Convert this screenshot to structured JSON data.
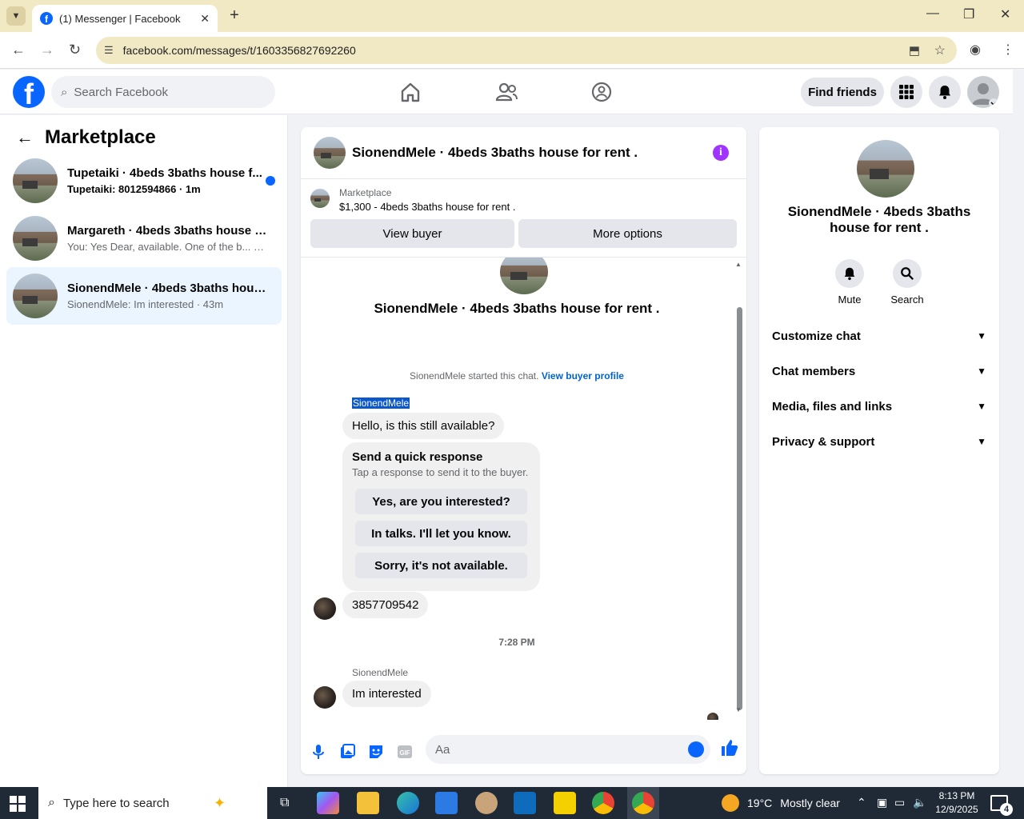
{
  "browser": {
    "tab_title": "(1) Messenger | Facebook",
    "url": "facebook.com/messages/t/1603356827692260"
  },
  "fb": {
    "search_placeholder": "Search Facebook",
    "find_friends": "Find friends"
  },
  "sidebar": {
    "title": "Marketplace",
    "conversations": [
      {
        "name": "Tupetaiki · 4beds 3baths house f...",
        "snippet": "Tupetaiki: 8012594866 · 1m",
        "unread": true,
        "active": false
      },
      {
        "name": "Margareth · 4beds 3baths house f...",
        "snippet": "You: Yes Dear, available. One of the b... · 2m",
        "unread": false,
        "active": false
      },
      {
        "name": "SionendMele · 4beds 3baths hous...",
        "snippet": "SionendMele: Im interested · 43m",
        "unread": false,
        "active": true
      }
    ]
  },
  "chat": {
    "header_title": "SionendMele · 4beds 3baths house for rent .",
    "marketplace_label": "Marketplace",
    "listing": "$1,300 - 4beds 3baths house for rent .",
    "view_buyer": "View buyer",
    "more_options": "More options",
    "intro_title": "SionendMele · 4beds 3baths house for rent .",
    "started_text": "SionendMele started this chat.",
    "view_buyer_profile": "View buyer profile",
    "sender_name": "SionendMele",
    "msg1": "Hello, is this still available?",
    "quick_title": "Send a quick response",
    "quick_sub": "Tap a response to send it to the buyer.",
    "quick_options": [
      "Yes, are you interested?",
      "In talks. I'll let you know.",
      "Sorry, it's not available."
    ],
    "msg2": "3857709542",
    "timestamp": "7:28 PM",
    "sender_name2": "SionendMele",
    "msg3": "Im interested",
    "input_placeholder": "Aa"
  },
  "details": {
    "title": "SionendMele · 4beds 3baths house for rent .",
    "mute": "Mute",
    "search": "Search",
    "sections": [
      "Customize chat",
      "Chat members",
      "Media, files and links",
      "Privacy & support"
    ]
  },
  "taskbar": {
    "search_placeholder": "Type here to search",
    "temperature": "19°C",
    "weather": "Mostly clear",
    "time": "8:13 PM",
    "date": "12/9/2025",
    "notifications": "4"
  }
}
